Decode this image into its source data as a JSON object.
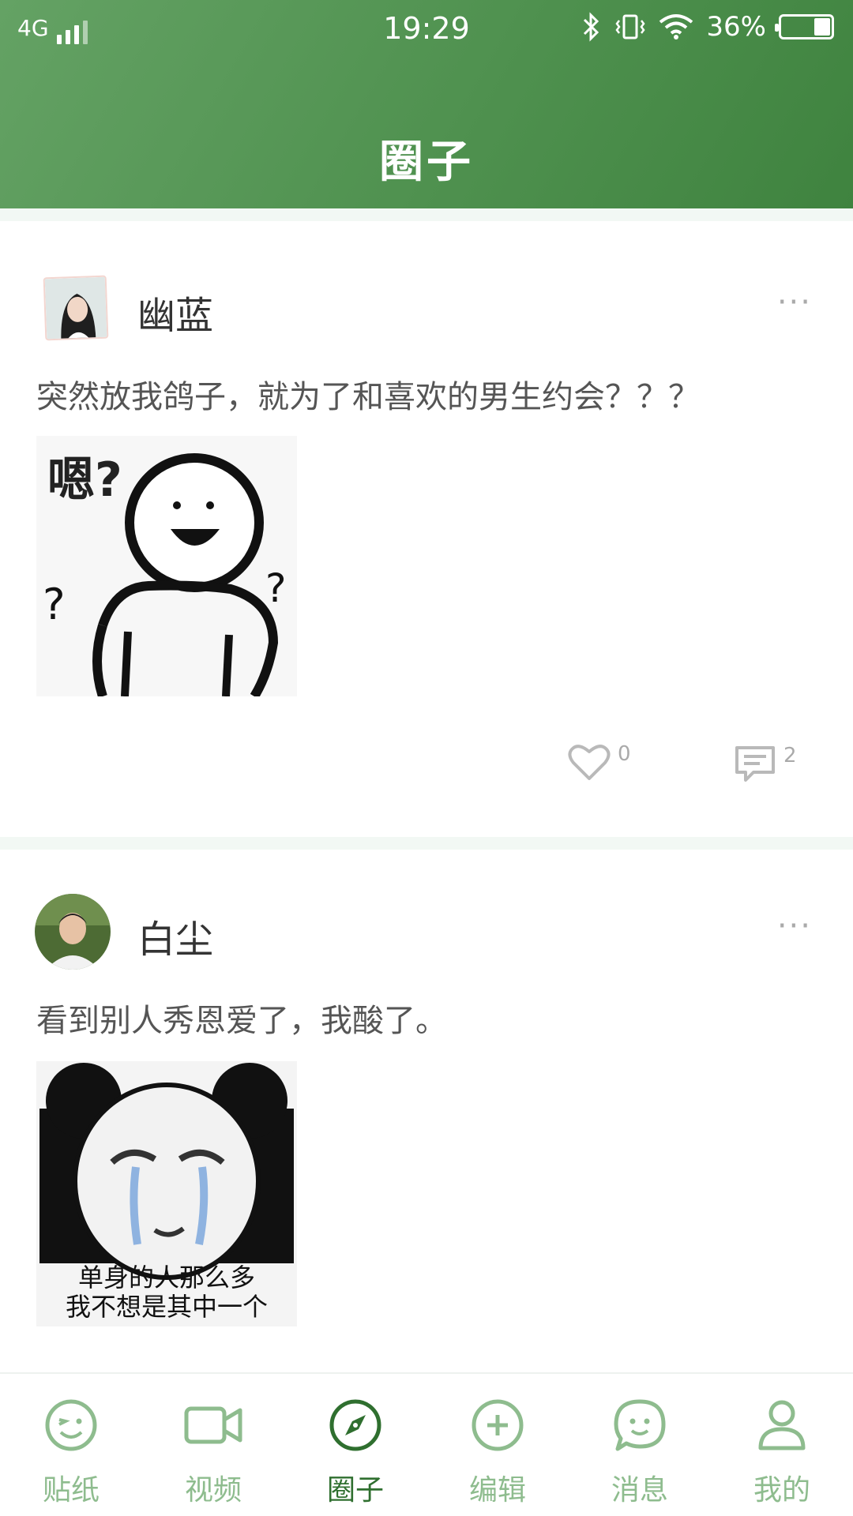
{
  "status_bar": {
    "network": "4G",
    "time": "19:29",
    "battery": "36%",
    "icons": [
      "signal-icon",
      "bluetooth-icon",
      "vibrate-icon",
      "wifi-icon",
      "battery-icon"
    ]
  },
  "header": {
    "title": "圈子"
  },
  "posts": [
    {
      "user": "幽蓝",
      "text": "突然放我鸽子，就为了和喜欢的男生约会？？？",
      "image_caption": [
        "嗯?",
        "?",
        "?"
      ],
      "likes": "0",
      "comments": "2"
    },
    {
      "user": "白尘",
      "text": "看到别人秀恩爱了，我酸了。",
      "image_caption": [
        "单身的人那么多",
        "我不想是其中一个"
      ]
    }
  ],
  "tabbar": {
    "items": [
      {
        "label": "贴纸",
        "icon": "sticker-icon"
      },
      {
        "label": "视频",
        "icon": "video-icon"
      },
      {
        "label": "圈子",
        "icon": "compass-icon",
        "active": true
      },
      {
        "label": "编辑",
        "icon": "add-icon"
      },
      {
        "label": "消息",
        "icon": "message-icon"
      },
      {
        "label": "我的",
        "icon": "user-icon"
      }
    ]
  },
  "colors": {
    "header": "#4f914f",
    "active": "#2f6f2f",
    "inactive": "#8ebc8e"
  }
}
